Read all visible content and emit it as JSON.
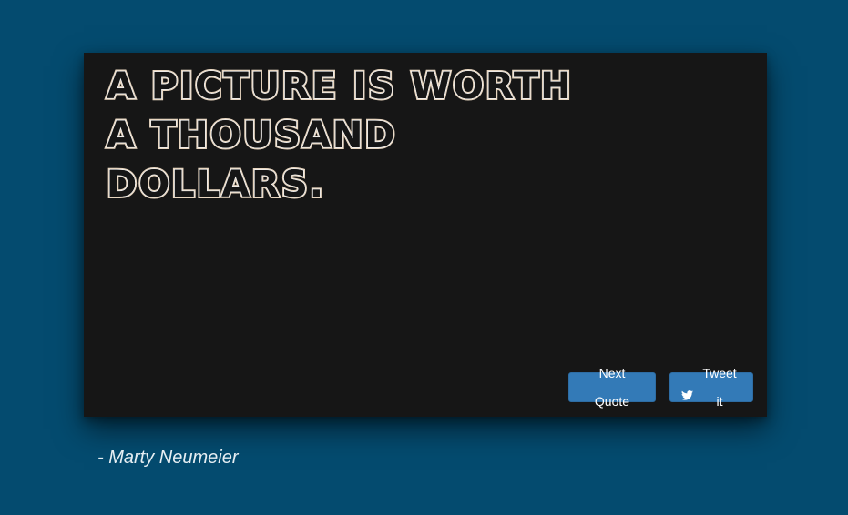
{
  "quote": {
    "text": "A picture is worth a thousand dollars.",
    "author": "- Marty Neumeier"
  },
  "buttons": {
    "next_label": "Next Quote",
    "tweet_label": "Tweet it",
    "tweet_icon": "twitter-icon"
  },
  "colors": {
    "background": "#044b6f",
    "card": "#161616",
    "button": "#337ab7",
    "quote_outline": "#f0f0f0"
  }
}
